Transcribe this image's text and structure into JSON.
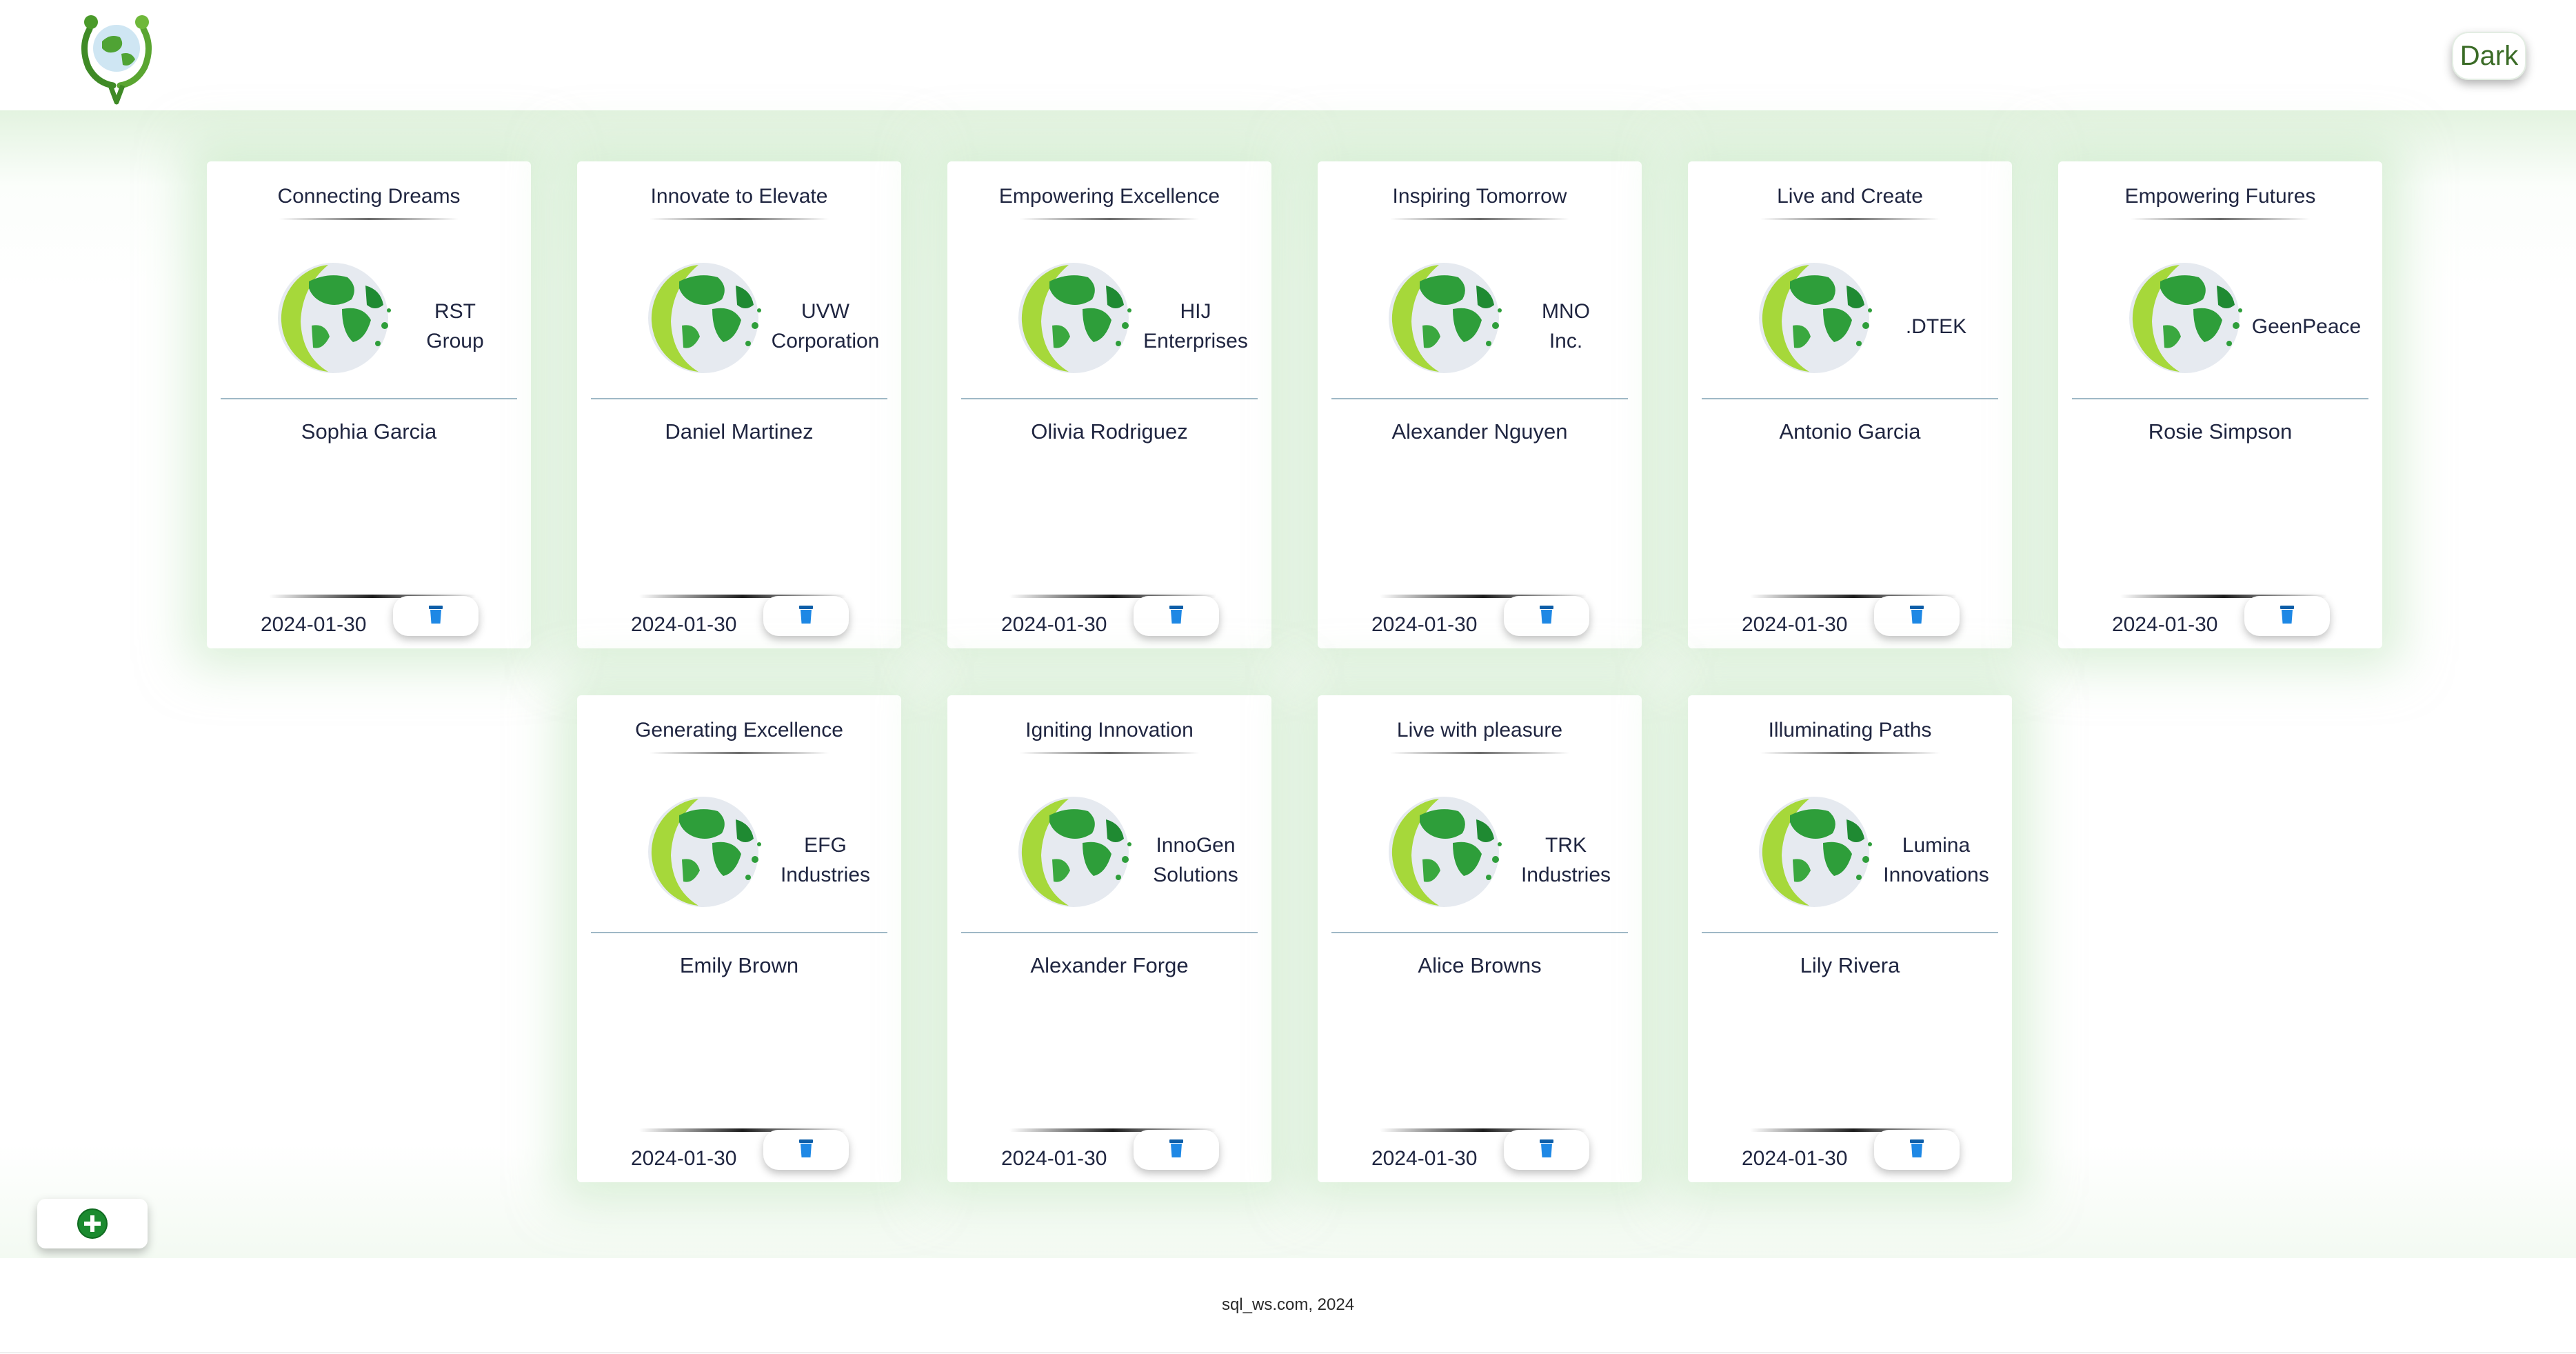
{
  "header": {
    "logo_icon": "people-holding-earth-logo",
    "theme_toggle_label": "Dark"
  },
  "cards": [
    {
      "title": "Connecting Dreams",
      "company_line1": "RST",
      "company_line2": "Group",
      "person": "Sophia Garcia",
      "date": "2024-01-30",
      "delete_icon": "trash-icon"
    },
    {
      "title": "Innovate to Elevate",
      "company_line1": "UVW",
      "company_line2": "Corporation",
      "person": "Daniel Martinez",
      "date": "2024-01-30",
      "delete_icon": "trash-icon"
    },
    {
      "title": "Empowering Excellence",
      "company_line1": "HIJ",
      "company_line2": "Enterprises",
      "person": "Olivia Rodriguez",
      "date": "2024-01-30",
      "delete_icon": "trash-icon"
    },
    {
      "title": "Inspiring Tomorrow",
      "company_line1": "MNO",
      "company_line2": "Inc.",
      "person": "Alexander Nguyen",
      "date": "2024-01-30",
      "delete_icon": "trash-icon"
    },
    {
      "title": "Live and Create",
      "company_line1": ".DTEK",
      "company_line2": "",
      "person": "Antonio Garcia",
      "date": "2024-01-30",
      "delete_icon": "trash-icon"
    },
    {
      "title": "Empowering Futures",
      "company_line1": "GeenPeace",
      "company_line2": "",
      "person": "Rosie Simpson",
      "date": "2024-01-30",
      "delete_icon": "trash-icon"
    },
    {
      "title": "Generating Excellence",
      "company_line1": "EFG",
      "company_line2": "Industries",
      "person": "Emily Brown",
      "date": "2024-01-30",
      "delete_icon": "trash-icon"
    },
    {
      "title": "Igniting Innovation",
      "company_line1": "InnoGen",
      "company_line2": "Solutions",
      "person": "Alexander Forge",
      "date": "2024-01-30",
      "delete_icon": "trash-icon"
    },
    {
      "title": "Live with pleasure",
      "company_line1": "TRK",
      "company_line2": "Industries",
      "person": "Alice Browns",
      "date": "2024-01-30",
      "delete_icon": "trash-icon"
    },
    {
      "title": "Illuminating Paths",
      "company_line1": "Lumina",
      "company_line2": "Innovations",
      "person": "Lily Rivera",
      "date": "2024-01-30",
      "delete_icon": "trash-icon"
    }
  ],
  "add_button": {
    "icon": "plus-circle-icon"
  },
  "footer": {
    "text": "sql_ws.com, 2024"
  },
  "colors": {
    "accent_green": "#3a6b26",
    "globe_green": "#2e9e3a",
    "text_dark": "#1f2540",
    "divider": "#9fb8c6",
    "trash_blue": "#1e88e5",
    "plus_green": "#1b8a2f"
  }
}
